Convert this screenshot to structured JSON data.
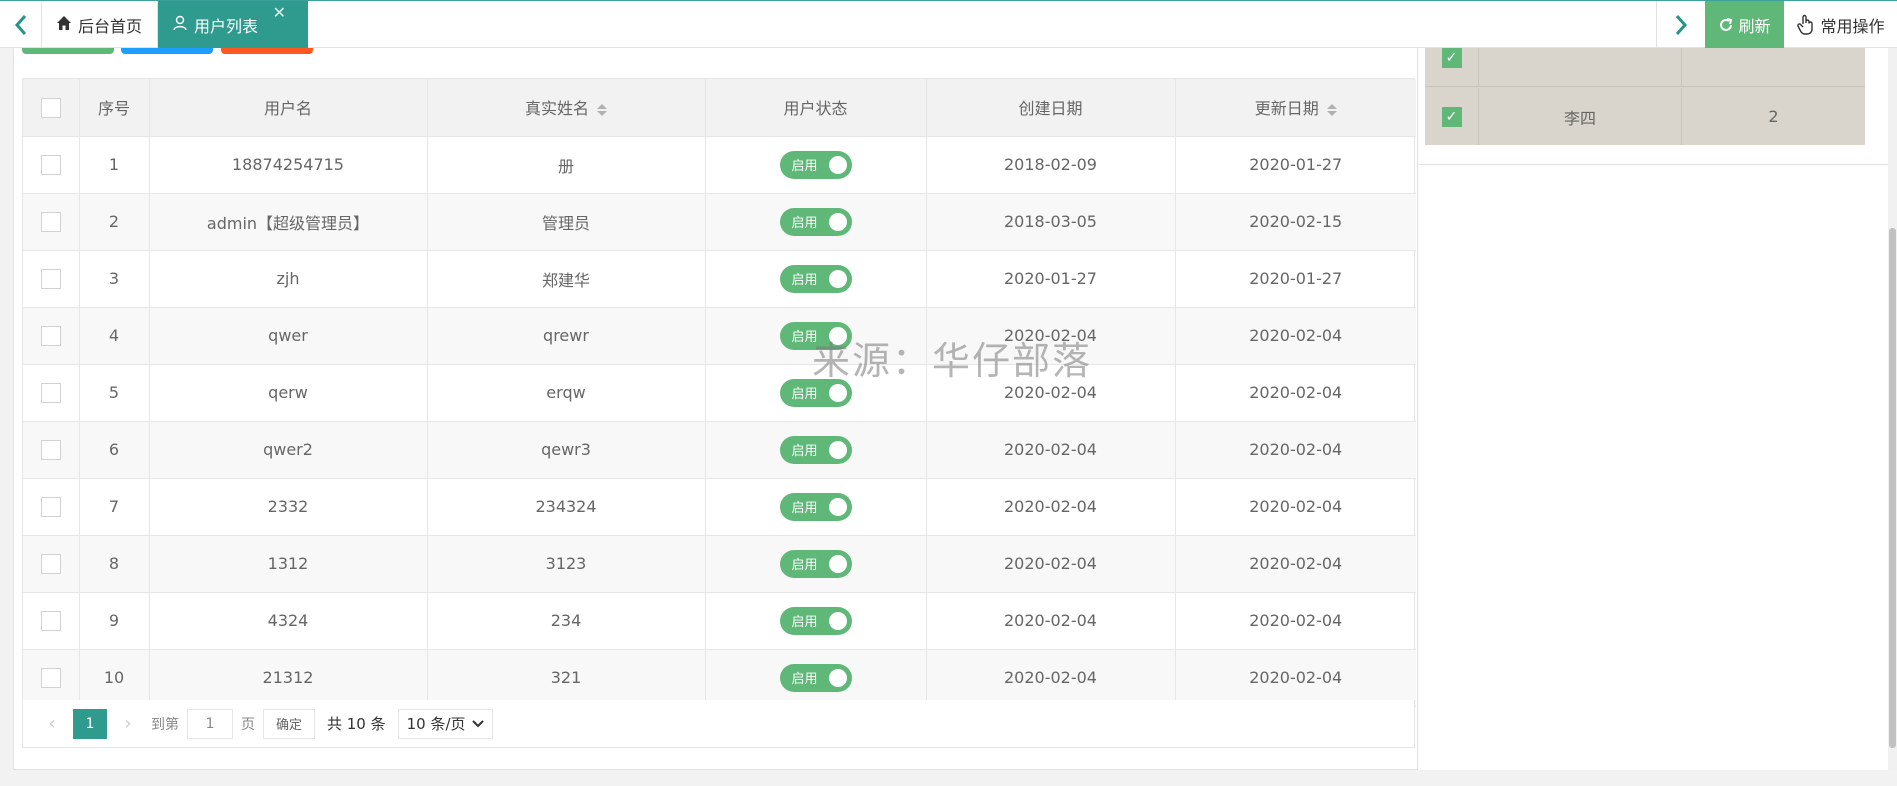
{
  "tabs": {
    "home_label": "后台首页",
    "users_label": "用户列表",
    "close_glyph": "✕"
  },
  "actions": {
    "refresh_label": "刷新",
    "ops_label": "常用操作"
  },
  "table": {
    "headers": {
      "index": "序号",
      "username": "用户名",
      "realname": "真实姓名",
      "status": "用户状态",
      "created": "创建日期",
      "updated": "更新日期"
    },
    "rows": [
      {
        "index": "1",
        "username": "18874254715",
        "realname": "册",
        "status": "启用",
        "created": "2018-02-09",
        "updated": "2020-01-27"
      },
      {
        "index": "2",
        "username": "admin【超级管理员】",
        "realname": "管理员",
        "status": "启用",
        "created": "2018-03-05",
        "updated": "2020-02-15"
      },
      {
        "index": "3",
        "username": "zjh",
        "realname": "郑建华",
        "status": "启用",
        "created": "2020-01-27",
        "updated": "2020-01-27"
      },
      {
        "index": "4",
        "username": "qwer",
        "realname": "qrewr",
        "status": "启用",
        "created": "2020-02-04",
        "updated": "2020-02-04"
      },
      {
        "index": "5",
        "username": "qerw",
        "realname": "erqw",
        "status": "启用",
        "created": "2020-02-04",
        "updated": "2020-02-04"
      },
      {
        "index": "6",
        "username": "qwer2",
        "realname": "qewr3",
        "status": "启用",
        "created": "2020-02-04",
        "updated": "2020-02-04"
      },
      {
        "index": "7",
        "username": "2332",
        "realname": "234324",
        "status": "启用",
        "created": "2020-02-04",
        "updated": "2020-02-04"
      },
      {
        "index": "8",
        "username": "1312",
        "realname": "3123",
        "status": "启用",
        "created": "2020-02-04",
        "updated": "2020-02-04"
      },
      {
        "index": "9",
        "username": "4324",
        "realname": "234",
        "status": "启用",
        "created": "2020-02-04",
        "updated": "2020-02-04"
      },
      {
        "index": "10",
        "username": "21312",
        "realname": "321",
        "status": "启用",
        "created": "2020-02-04",
        "updated": "2020-02-04"
      }
    ]
  },
  "pager": {
    "current_page": "1",
    "goto_label": "到第",
    "goto_value": "1",
    "page_unit": "页",
    "confirm_label": "确定",
    "total_label": "共 10 条",
    "page_size_label": "10 条/页"
  },
  "side_table": {
    "row1": {
      "name": "",
      "value": ""
    },
    "row2": {
      "name": "李四",
      "value": "2"
    }
  },
  "watermark": "来源：华仔部落",
  "colors": {
    "accent": "#2f9b8f",
    "switch_on": "#5fb878",
    "side_panel_bg": "#d9d4cc"
  }
}
